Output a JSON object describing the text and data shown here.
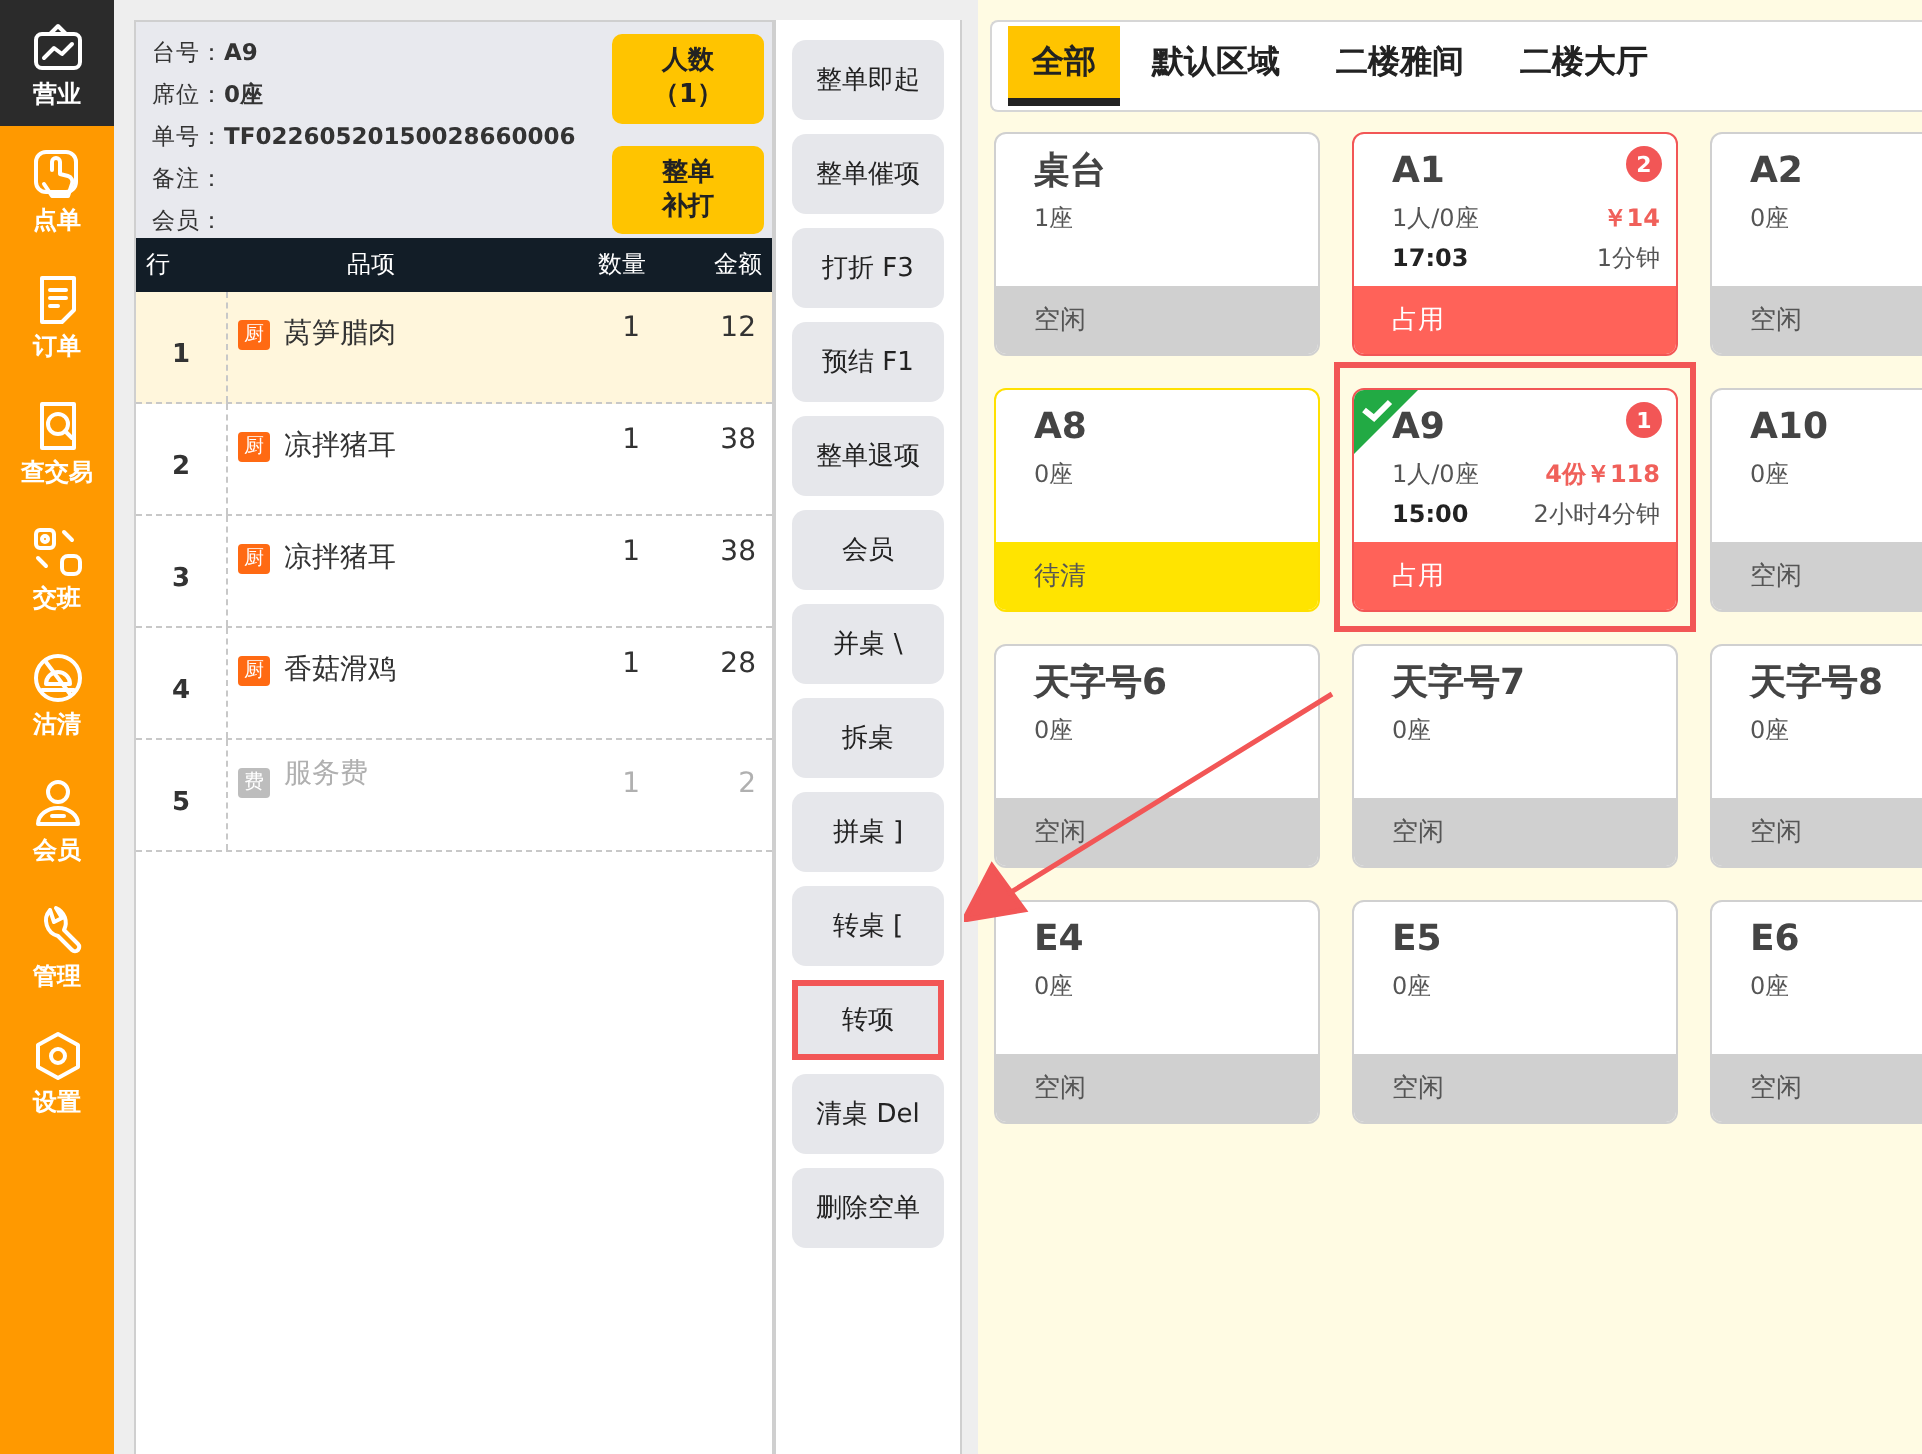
{
  "sidebar": {
    "items": [
      {
        "label": "营业",
        "selected": true
      },
      {
        "label": "点单",
        "selected": false
      },
      {
        "label": "订单",
        "selected": false
      },
      {
        "label": "查交易",
        "selected": false
      },
      {
        "label": "交班",
        "selected": false
      },
      {
        "label": "沽清",
        "selected": false
      },
      {
        "label": "会员",
        "selected": false
      },
      {
        "label": "管理",
        "selected": false
      },
      {
        "label": "设置",
        "selected": false
      }
    ]
  },
  "order": {
    "info": [
      {
        "label": "台号：",
        "value": "A9"
      },
      {
        "label": "席位：",
        "value": "0座"
      },
      {
        "label": "单号：",
        "value": "TF02260520150028660006"
      },
      {
        "label": "备注："
      },
      {
        "label": "会员："
      }
    ],
    "actions": [
      {
        "lines": [
          "人数",
          "（1）"
        ]
      },
      {
        "lines": [
          "整单",
          "补打"
        ]
      }
    ],
    "columns": [
      "行",
      "品项",
      "数量",
      "金额"
    ],
    "rows": [
      {
        "no": "1",
        "tag": "厨",
        "kind": "kitchen",
        "name": "莴笋腊肉",
        "qty": "1",
        "amount": "12",
        "selected": true,
        "disabled": false
      },
      {
        "no": "2",
        "tag": "厨",
        "kind": "kitchen",
        "name": "凉拌猪耳",
        "qty": "1",
        "amount": "38",
        "selected": false,
        "disabled": false
      },
      {
        "no": "3",
        "tag": "厨",
        "kind": "kitchen",
        "name": "凉拌猪耳",
        "qty": "1",
        "amount": "38",
        "selected": false,
        "disabled": false
      },
      {
        "no": "4",
        "tag": "厨",
        "kind": "kitchen",
        "name": "香菇滑鸡",
        "qty": "1",
        "amount": "28",
        "selected": false,
        "disabled": false
      },
      {
        "no": "5",
        "tag": "费",
        "kind": "fee",
        "name": "服务费",
        "qty": "1",
        "amount": "2",
        "selected": false,
        "disabled": true
      }
    ]
  },
  "commands": [
    {
      "label": "整单即起",
      "highlighted": false
    },
    {
      "label": "整单催项",
      "highlighted": false
    },
    {
      "label": "打折 F3",
      "highlighted": false
    },
    {
      "label": "预结 F1",
      "highlighted": false
    },
    {
      "label": "整单退项",
      "highlighted": false
    },
    {
      "label": "会员",
      "highlighted": false
    },
    {
      "label": "并桌 \\",
      "highlighted": false
    },
    {
      "label": "拆桌",
      "highlighted": false
    },
    {
      "label": "拼桌 ]",
      "highlighted": false
    },
    {
      "label": "转桌 [",
      "highlighted": false
    },
    {
      "label": "转项",
      "highlighted": true
    },
    {
      "label": "清桌 Del",
      "highlighted": false
    },
    {
      "label": "删除空单",
      "highlighted": false
    }
  ],
  "area_tabs": [
    {
      "label": "全部",
      "selected": true
    },
    {
      "label": "默认区域",
      "selected": false
    },
    {
      "label": "二楼雅间",
      "selected": false
    },
    {
      "label": "二楼大厅",
      "selected": false
    }
  ],
  "tables": [
    {
      "name": "桌台",
      "seats": "1座",
      "status": "空闲",
      "kind": "idle",
      "checked": false,
      "highlighted": false
    },
    {
      "name": "A1",
      "badge": "2",
      "seats": "1人/0座",
      "price": "￥14",
      "time": "17:03",
      "duration": "1分钟",
      "status": "占用",
      "kind": "occupied",
      "checked": false,
      "highlighted": false
    },
    {
      "name": "A2",
      "seats": "0座",
      "status": "空闲",
      "kind": "idle",
      "checked": false,
      "highlighted": false
    },
    {
      "name": "A8",
      "seats": "0座",
      "status": "待清",
      "kind": "to_clean",
      "checked": false,
      "highlighted": false
    },
    {
      "name": "A9",
      "badge": "1",
      "seats": "1人/0座",
      "price": "4份￥118",
      "time": "15:00",
      "duration": "2小时4分钟",
      "status": "占用",
      "kind": "occupied",
      "checked": true,
      "highlighted": true
    },
    {
      "name": "A10",
      "seats": "0座",
      "status": "空闲",
      "kind": "idle",
      "checked": false,
      "highlighted": false
    },
    {
      "name": "天字号6",
      "seats": "0座",
      "status": "空闲",
      "kind": "idle",
      "checked": false,
      "highlighted": false
    },
    {
      "name": "天字号7",
      "seats": "0座",
      "status": "空闲",
      "kind": "idle",
      "checked": false,
      "highlighted": false
    },
    {
      "name": "天字号8",
      "seats": "0座",
      "status": "空闲",
      "kind": "idle",
      "checked": false,
      "highlighted": false
    },
    {
      "name": "E4",
      "seats": "0座",
      "status": "空闲",
      "kind": "idle",
      "checked": false,
      "highlighted": false
    },
    {
      "name": "E5",
      "seats": "0座",
      "status": "空闲",
      "kind": "idle",
      "checked": false,
      "highlighted": false
    },
    {
      "name": "E6",
      "seats": "0座",
      "status": "空闲",
      "kind": "idle",
      "checked": false,
      "highlighted": false
    }
  ]
}
